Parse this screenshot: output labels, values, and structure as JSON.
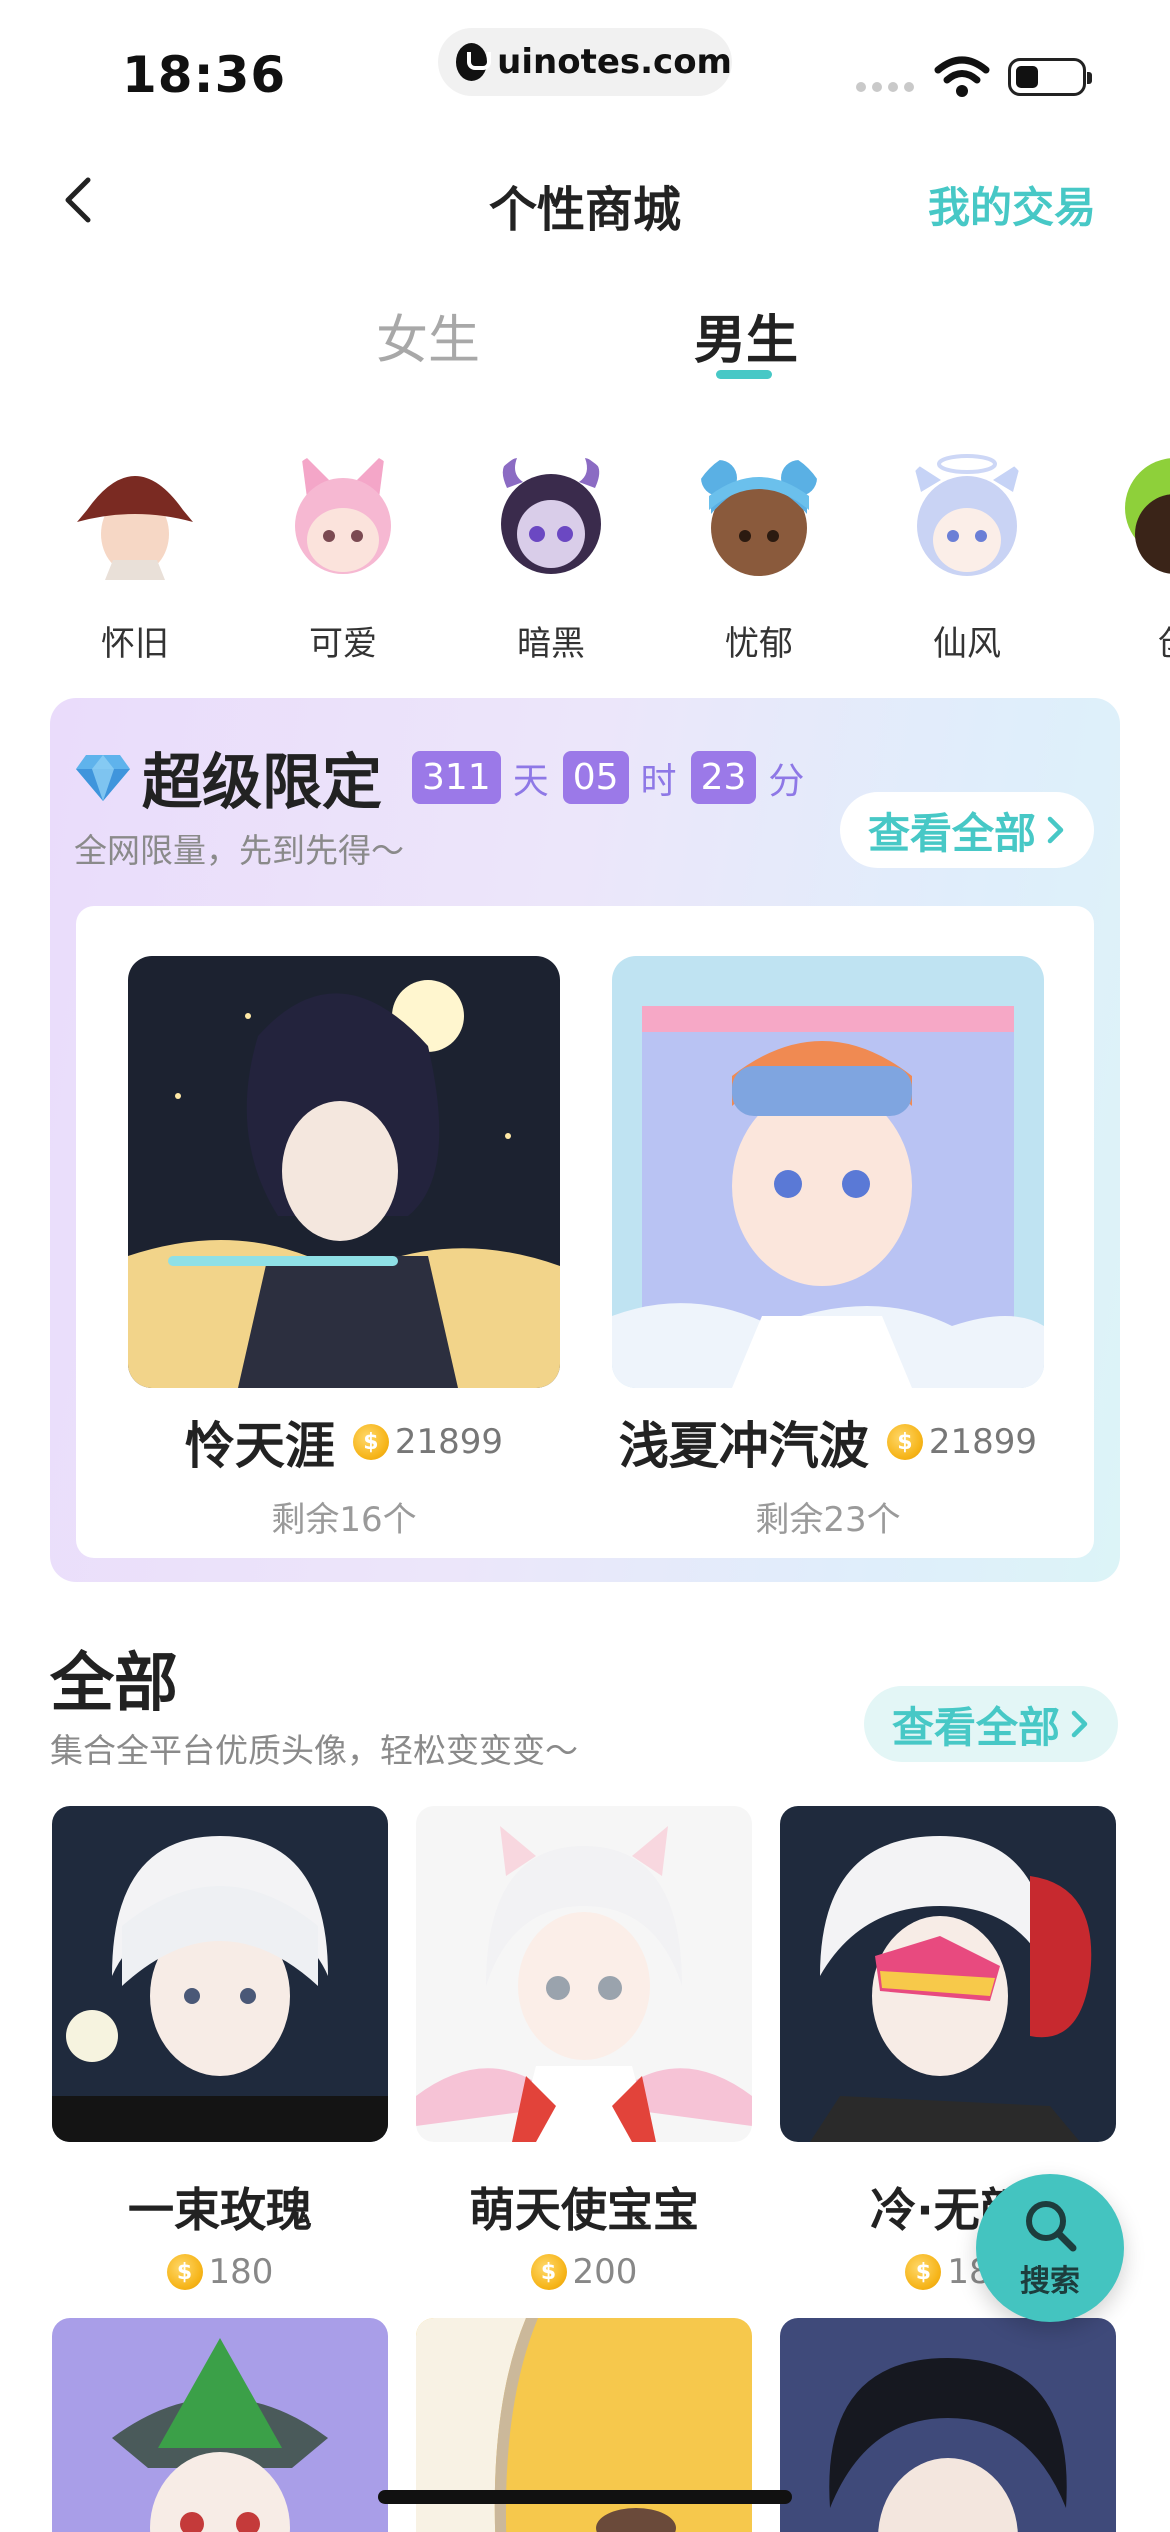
{
  "status_bar": {
    "time": "18:36",
    "url": "uinotes.com"
  },
  "nav": {
    "title": "个性商城",
    "action": "我的交易"
  },
  "gender_tabs": {
    "girl": "女生",
    "boy": "男生"
  },
  "categories": [
    "怀旧",
    "可爱",
    "暗黑",
    "忧郁",
    "仙风",
    "创"
  ],
  "limited": {
    "title": "超级限定",
    "countdown": {
      "days": "311",
      "days_unit": "天",
      "hours": "05",
      "hours_unit": "时",
      "minutes": "23",
      "minutes_unit": "分"
    },
    "subtitle": "全网限量，先到先得～",
    "view_all": "查看全部",
    "items": [
      {
        "name": "怜天涯",
        "price": "21899",
        "remaining": "剩余16个"
      },
      {
        "name": "浅夏冲汽波",
        "price": "21899",
        "remaining": "剩余23个"
      }
    ]
  },
  "all": {
    "title": "全部",
    "subtitle": "集合全平台优质头像，轻松变变变～",
    "view_all": "查看全部",
    "items": [
      {
        "name": "一束玫瑰",
        "price": "180"
      },
      {
        "name": "萌天使宝宝",
        "price": "200"
      },
      {
        "name": "冷·无颜",
        "price": "18"
      }
    ]
  },
  "search_fab": {
    "label": "搜索"
  },
  "colors": {
    "accent": "#47c8c6",
    "countdown": "#9b79e8",
    "coin": "#f6b418"
  }
}
